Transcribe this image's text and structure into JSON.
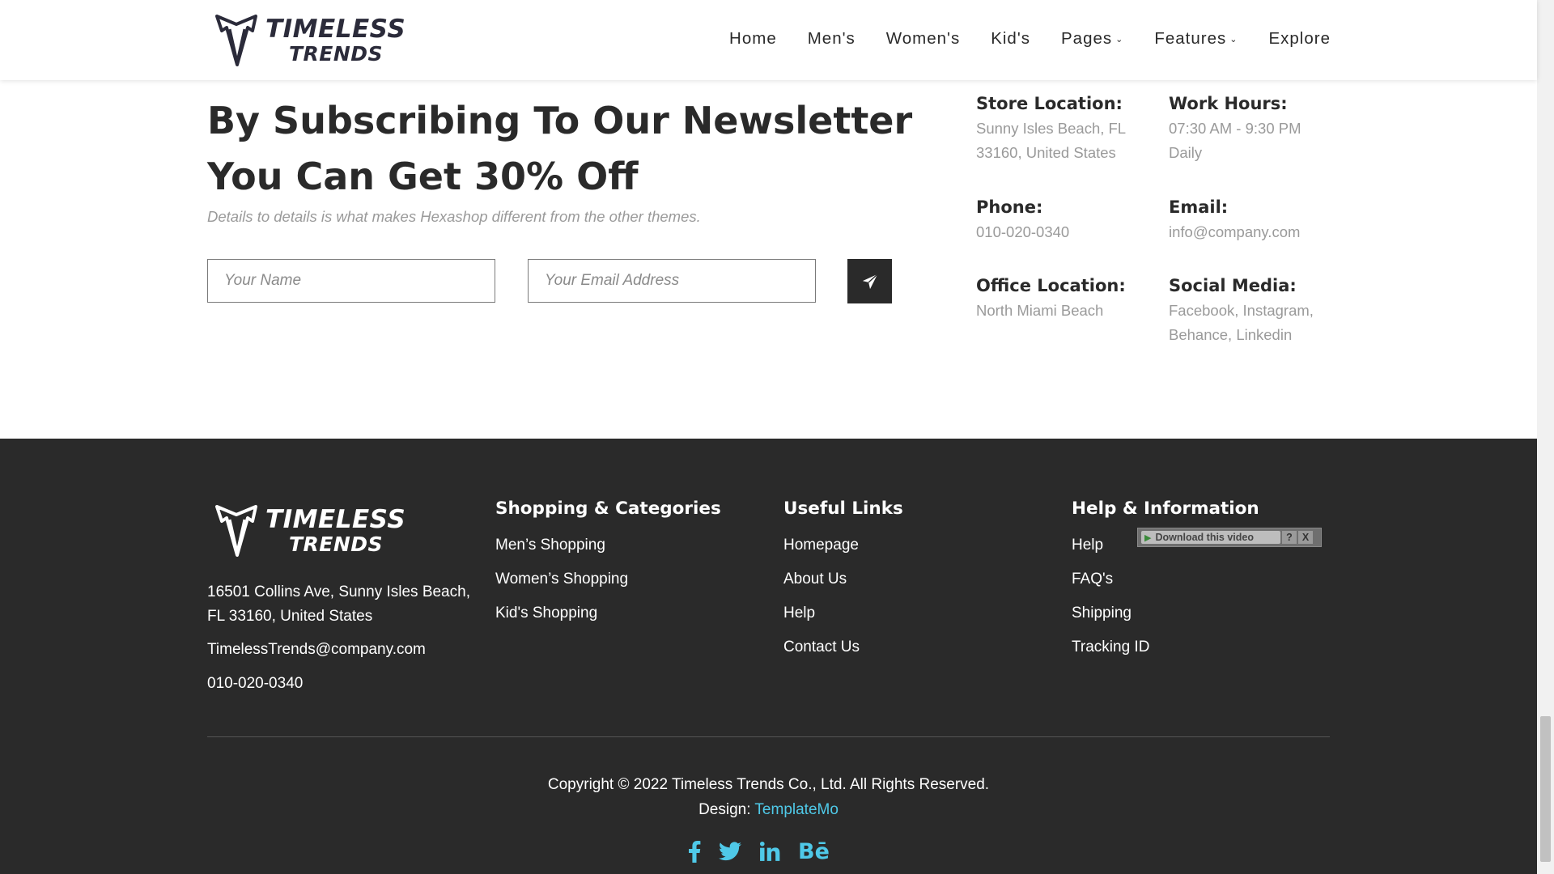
{
  "header": {
    "brand_top": "TIMELESS",
    "brand_bottom": "TRENDS",
    "nav": [
      {
        "label": "Home",
        "dropdown": false
      },
      {
        "label": "Men's",
        "dropdown": false
      },
      {
        "label": "Women's",
        "dropdown": false
      },
      {
        "label": "Kid's",
        "dropdown": false
      },
      {
        "label": "Pages",
        "dropdown": true
      },
      {
        "label": "Features",
        "dropdown": true
      },
      {
        "label": "Explore",
        "dropdown": false
      }
    ]
  },
  "subscribe": {
    "title": "By Subscribing To Our Newsletter You Can Get 30% Off",
    "description": "Details to details is what makes Hexashop different from the other themes.",
    "name_placeholder": "Your Name",
    "email_placeholder": "Your Email Address",
    "send_icon": "paper-plane-icon"
  },
  "contact": {
    "store_location": {
      "label": "Store Location:",
      "value": "Sunny Isles Beach, FL 33160, United States"
    },
    "work_hours": {
      "label": "Work Hours:",
      "value": "07:30 AM - 9:30 PM Daily"
    },
    "phone": {
      "label": "Phone:",
      "value": "010-020-0340"
    },
    "email": {
      "label": "Email:",
      "value": "info@company.com"
    },
    "office_location": {
      "label": "Office Location:",
      "value": "North Miami Beach"
    },
    "social_media": {
      "label": "Social Media:",
      "value": "Facebook, Instagram, Behance, Linkedin"
    }
  },
  "footer": {
    "brand_top": "TIMELESS",
    "brand_bottom": "TRENDS",
    "address": "16501 Collins Ave, Sunny Isles Beach, FL 33160, United States",
    "email": "TimelessTrends@company.com",
    "phone": "010-020-0340",
    "shopping": {
      "title": "Shopping & Categories",
      "links": [
        "Men’s Shopping",
        "Women’s Shopping",
        "Kid's Shopping"
      ]
    },
    "useful": {
      "title": "Useful Links",
      "links": [
        "Homepage",
        "About Us",
        "Help",
        "Contact Us"
      ]
    },
    "help": {
      "title": "Help & Information",
      "links": [
        "Help",
        "FAQ's",
        "Shipping",
        "Tracking ID"
      ]
    },
    "copyright": "Copyright © 2022 Timeless Trends Co., Ltd. All Rights Reserved.",
    "design_label": "Design:",
    "design_link": "TemplateMo",
    "social_icons": [
      "facebook-icon",
      "twitter-icon",
      "linkedin-icon",
      "behance-icon"
    ],
    "behance_text": "Bē"
  },
  "download_widget": {
    "label": "Download this video",
    "help": "?",
    "close": "X"
  },
  "colors": {
    "dark": "#2a2a2a",
    "muted": "#9a9a9a",
    "accent": "#4fc9e8"
  }
}
